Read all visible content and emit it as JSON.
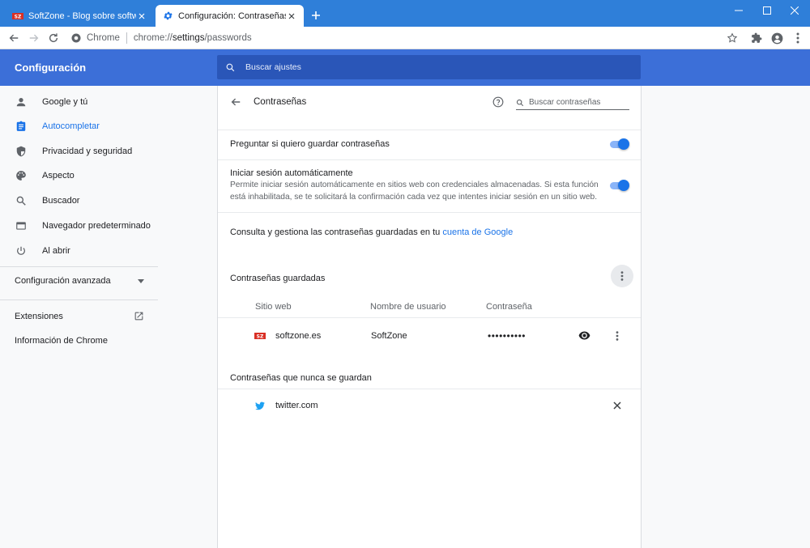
{
  "browser": {
    "tabs": [
      {
        "title": "SoftZone - Blog sobre software, W",
        "active": false
      },
      {
        "title": "Configuración: Contraseñas",
        "active": true
      }
    ],
    "omnibox": {
      "site_label": "Chrome",
      "url_prefix": "chrome://",
      "url_path": "settings",
      "url_suffix": "/passwords"
    }
  },
  "settings": {
    "app_title": "Configuración",
    "search_placeholder": "Buscar ajustes",
    "sidebar": {
      "items": [
        {
          "label": "Google y tú",
          "icon": "person-icon"
        },
        {
          "label": "Autocompletar",
          "icon": "clipboard-icon",
          "active": true
        },
        {
          "label": "Privacidad y seguridad",
          "icon": "shield-icon"
        },
        {
          "label": "Aspecto",
          "icon": "palette-icon"
        },
        {
          "label": "Buscador",
          "icon": "search-icon"
        },
        {
          "label": "Navegador predeterminado",
          "icon": "browser-window-icon"
        },
        {
          "label": "Al abrir",
          "icon": "power-icon"
        }
      ],
      "advanced_label": "Configuración avanzada",
      "extensions_label": "Extensiones",
      "about_label": "Información de Chrome"
    },
    "passwords": {
      "page_title": "Contraseñas",
      "search_placeholder": "Buscar contraseñas",
      "offer_to_save_label": "Preguntar si quiero guardar contraseñas",
      "offer_to_save_on": true,
      "auto_signin_label": "Iniciar sesión automáticamente",
      "auto_signin_desc_line1": "Permite iniciar sesión automáticamente en sitios web con credenciales almacenadas. Si esta función",
      "auto_signin_desc_line2": "está inhabilitada, se te solicitará la confirmación cada vez que intentes iniciar sesión en un sitio web.",
      "auto_signin_on": true,
      "manage_text": "Consulta y gestiona las contraseñas guardadas en tu ",
      "manage_link": "cuenta de Google",
      "saved_heading": "Contraseñas guardadas",
      "columns": [
        "Sitio web",
        "Nombre de usuario",
        "Contraseña"
      ],
      "saved_entries": [
        {
          "site": "softzone.es",
          "username": "SoftZone",
          "password": "••••••••••"
        }
      ],
      "never_saved_heading": "Contraseñas que nunca se guardan",
      "never_saved_entries": [
        {
          "site": "twitter.com"
        }
      ]
    }
  },
  "colors": {
    "accent": "#1a73e8",
    "header": "#3c6fd8",
    "titlebar": "#2f7fd9"
  }
}
